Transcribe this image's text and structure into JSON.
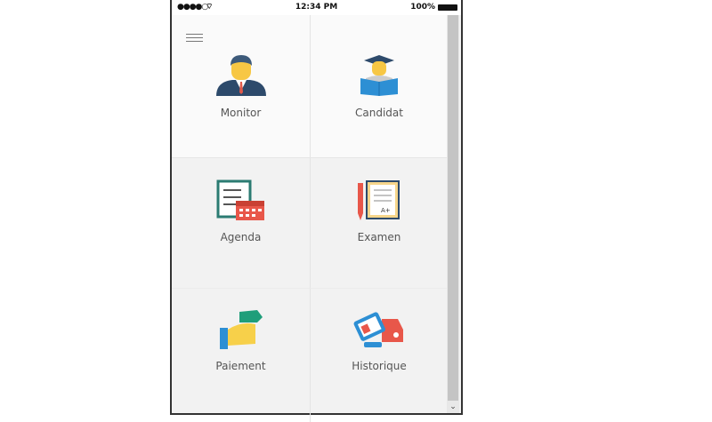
{
  "status": {
    "signal": "●●●●○",
    "wifi": "wifi-icon",
    "time": "12:34 PM",
    "battery": "100%"
  },
  "menu": {
    "icon": "hamburger-menu-icon"
  },
  "tiles": [
    {
      "label": "Monitor",
      "icon": "instructor-icon"
    },
    {
      "label": "Candidat",
      "icon": "graduate-reading-icon"
    },
    {
      "label": "Agenda",
      "icon": "checklist-calendar-icon"
    },
    {
      "label": "Examen",
      "icon": "exam-paper-pencil-icon"
    },
    {
      "label": "Paiement",
      "icon": "hand-money-icon"
    },
    {
      "label": "Historique",
      "icon": "license-car-icon"
    }
  ],
  "scrollbar": {
    "arrow": "⌄"
  }
}
